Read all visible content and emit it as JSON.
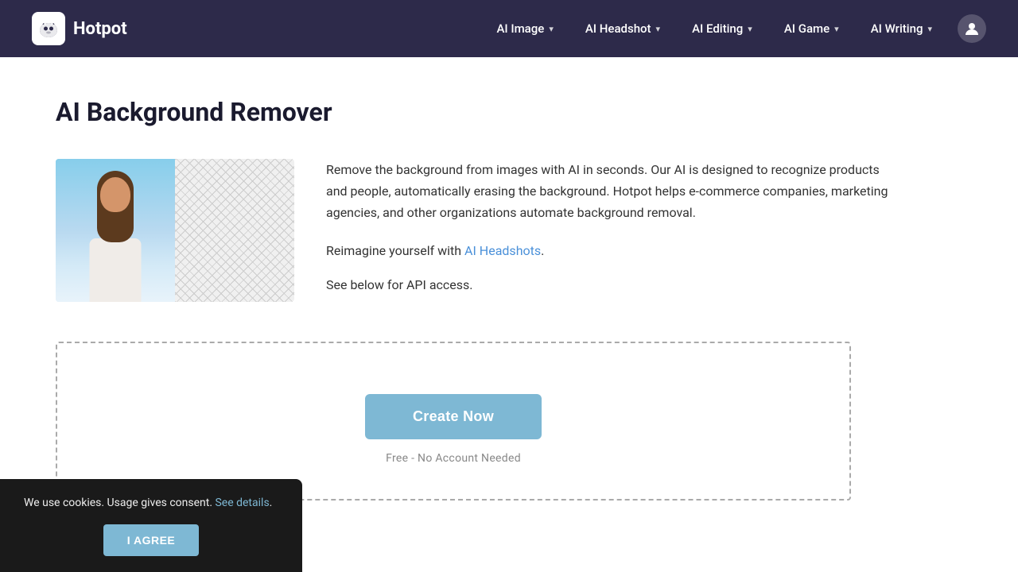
{
  "navbar": {
    "brand": {
      "name": "Hotpot",
      "logo_emoji": "🐱"
    },
    "nav_items": [
      {
        "id": "ai-image",
        "label": "AI Image",
        "has_dropdown": true
      },
      {
        "id": "ai-headshot",
        "label": "AI Headshot",
        "has_dropdown": true
      },
      {
        "id": "ai-editing",
        "label": "AI Editing",
        "has_dropdown": true
      },
      {
        "id": "ai-game",
        "label": "AI Game",
        "has_dropdown": true
      },
      {
        "id": "ai-writing",
        "label": "AI Writing",
        "has_dropdown": true
      }
    ],
    "user_icon": "👤"
  },
  "page": {
    "title": "AI Background Remover",
    "description": "Remove the background from images with AI in seconds. Our AI is designed to recognize products and people, automatically erasing the background. Hotpot helps e-commerce companies, marketing agencies, and other organizations automate background removal.",
    "reimagine_text": "Reimagine yourself with ",
    "ai_headshots_link": "AI Headshots",
    "api_text": "See below for API access.",
    "upload": {
      "create_now_label": "Create Now",
      "no_account_label": "Free - No Account Needed"
    }
  },
  "cookie": {
    "text": "We use cookies. Usage gives consent. ",
    "see_details_link": "See details",
    "period": ".",
    "agree_label": "I AGREE"
  },
  "colors": {
    "navbar_bg": "#2d2a4a",
    "button_blue": "#7eb8d4",
    "link_blue": "#4a90d9",
    "cookie_bg": "#1a1a1a"
  }
}
